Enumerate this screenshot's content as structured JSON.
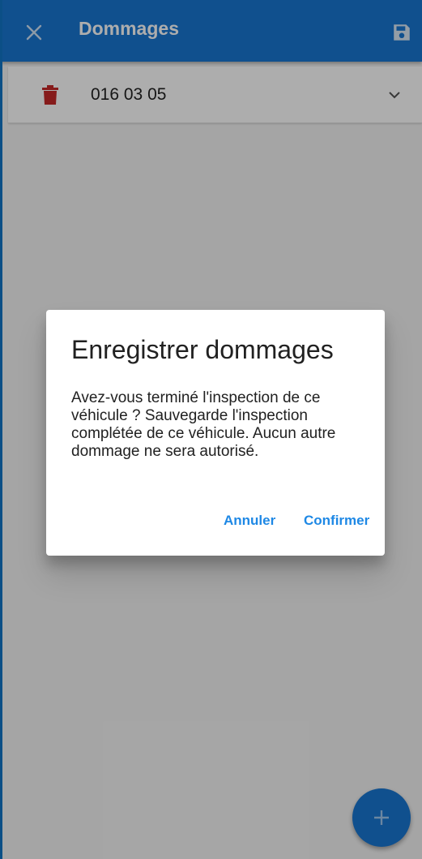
{
  "app_bar": {
    "title": "Dommages",
    "close_icon": "close-icon",
    "save_icon": "floppy-disk-icon",
    "color": "#1976d2"
  },
  "damage_list": {
    "items": [
      {
        "code": "016 03  05",
        "delete_icon": "trash-icon",
        "expand_icon": "chevron-down-icon"
      }
    ]
  },
  "dialog": {
    "title": "Enregistrer dommages",
    "body": "Avez-vous terminé l'inspection de ce véhicule ? Sauvegarde l'inspection complétée de ce véhicule. Aucun autre dommage ne sera autorisé.",
    "cancel_label": "Annuler",
    "confirm_label": "Confirmer"
  },
  "fab": {
    "icon": "plus-icon"
  },
  "colors": {
    "accent": "#1e88e5",
    "delete": "#c62828",
    "frame": "#0b4f86"
  }
}
